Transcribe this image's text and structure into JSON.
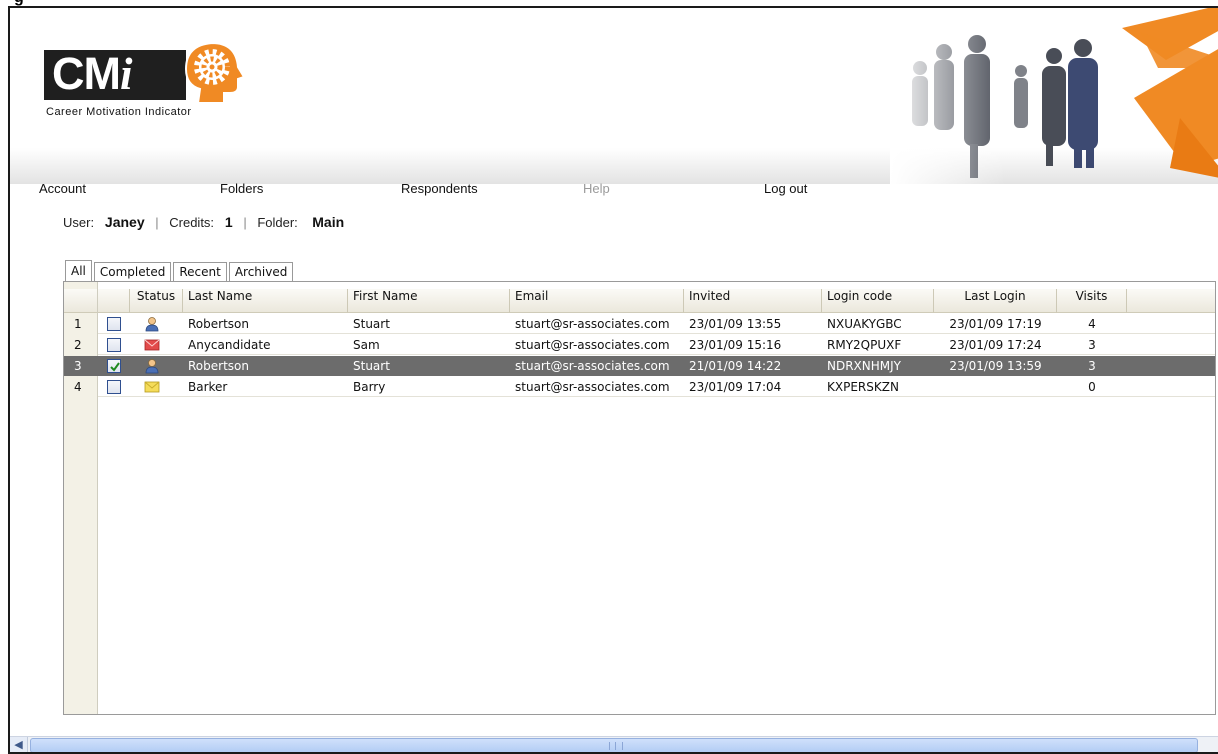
{
  "page_heading_fragment": "g",
  "app": {
    "logo_text": "CM",
    "logo_i": "i",
    "tagline": "Career Motivation Indicator"
  },
  "nav": {
    "account": "Account",
    "folders": "Folders",
    "respondents": "Respondents",
    "help": "Help",
    "logout": "Log out"
  },
  "info": {
    "user_label": "User:",
    "user_value": "Janey",
    "credits_label": "Credits:",
    "credits_value": "1",
    "folder_label": "Folder:",
    "folder_value": "Main",
    "separator": "|"
  },
  "tabs": [
    "All",
    "Completed",
    "Recent",
    "Archived"
  ],
  "active_tab": "All",
  "columns": {
    "status": "Status",
    "last_name": "Last Name",
    "first_name": "First Name",
    "email": "Email",
    "invited": "Invited",
    "login_code": "Login code",
    "last_login": "Last Login",
    "visits": "Visits"
  },
  "rows": [
    {
      "num": "1",
      "checked": false,
      "status_icon": "person-icon",
      "last_name": "Robertson",
      "first_name": "Stuart",
      "email": "stuart@sr-associates.com",
      "invited": "23/01/09 13:55",
      "login_code": "NXUAKYGBC",
      "last_login": "23/01/09 17:19",
      "visits": "4",
      "selected": false
    },
    {
      "num": "2",
      "checked": false,
      "status_icon": "envelope-red-icon",
      "last_name": "Anycandidate",
      "first_name": "Sam",
      "email": "stuart@sr-associates.com",
      "invited": "23/01/09 15:16",
      "login_code": "RMY2QPUXF",
      "last_login": "23/01/09 17:24",
      "visits": "3",
      "selected": false
    },
    {
      "num": "3",
      "checked": true,
      "status_icon": "person-icon",
      "last_name": "Robertson",
      "first_name": "Stuart",
      "email": "stuart@sr-associates.com",
      "invited": "21/01/09 14:22",
      "login_code": "NDRXNHMJY",
      "last_login": "23/01/09 13:59",
      "visits": "3",
      "selected": true
    },
    {
      "num": "4",
      "checked": false,
      "status_icon": "envelope-yellow-icon",
      "last_name": "Barker",
      "first_name": "Barry",
      "email": "stuart@sr-associates.com",
      "invited": "23/01/09 17:04",
      "login_code": "KXPERSKZN",
      "last_login": "",
      "visits": "0",
      "selected": false
    }
  ],
  "colors": {
    "accent_orange": "#f08a24",
    "selected_row": "#6c6c6c",
    "grid_header": "#ebe8dc"
  }
}
